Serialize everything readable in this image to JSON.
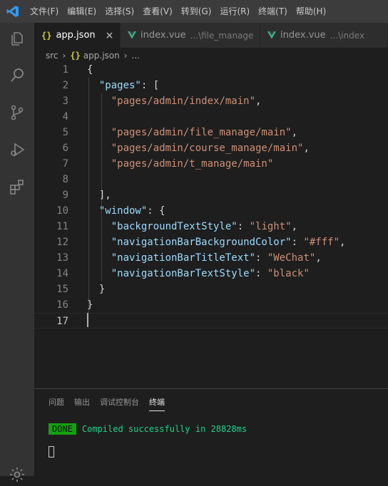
{
  "menu": [
    "文件(F)",
    "编辑(E)",
    "选择(S)",
    "查看(V)",
    "转到(G)",
    "运行(R)",
    "终端(T)",
    "帮助(H)"
  ],
  "tabs": [
    {
      "icon": "json-icon",
      "glyph": "{}",
      "label": "app.json",
      "desc": "",
      "active": true,
      "close": "×"
    },
    {
      "icon": "vue-icon",
      "label": "index.vue",
      "desc": "...\\file_manage",
      "active": false
    },
    {
      "icon": "vue-icon",
      "label": "index.vue",
      "desc": "...\\index",
      "active": false
    }
  ],
  "breadcrumb": {
    "folder": "src",
    "file_glyph": "{}",
    "file": "app.json",
    "more": "..."
  },
  "editor": {
    "line_numbers": [
      "1",
      "2",
      "3",
      "4",
      "5",
      "6",
      "7",
      "8",
      "9",
      "10",
      "11",
      "12",
      "13",
      "14",
      "15",
      "16",
      "17"
    ],
    "current_line": "17",
    "lines": [
      "{",
      "  \"pages\": [",
      "    \"pages/admin/index/main\",",
      "",
      "    \"pages/admin/file_manage/main\",",
      "    \"pages/admin/course_manage/main\",",
      "    \"pages/admin/t_manage/main\"",
      "",
      "  ],",
      "  \"window\": {",
      "    \"backgroundTextStyle\": \"light\",",
      "    \"navigationBarBackgroundColor\": \"#fff\",",
      "    \"navigationBarTitleText\": \"WeChat\",",
      "    \"navigationBarTextStyle\": \"black\"",
      "  }",
      "}",
      ""
    ]
  },
  "panel": {
    "tabs": [
      "问题",
      "输出",
      "调试控制台",
      "终端"
    ],
    "active_tab": "终端",
    "terminal": {
      "badge": "DONE",
      "message": "Compiled successfully in 28828ms"
    }
  },
  "colors": {
    "accent": "#007acc",
    "json": "#cbcb41",
    "vue": "#41b883",
    "key": "#9cdcfe",
    "string": "#ce9178",
    "success": "#23d18b"
  }
}
